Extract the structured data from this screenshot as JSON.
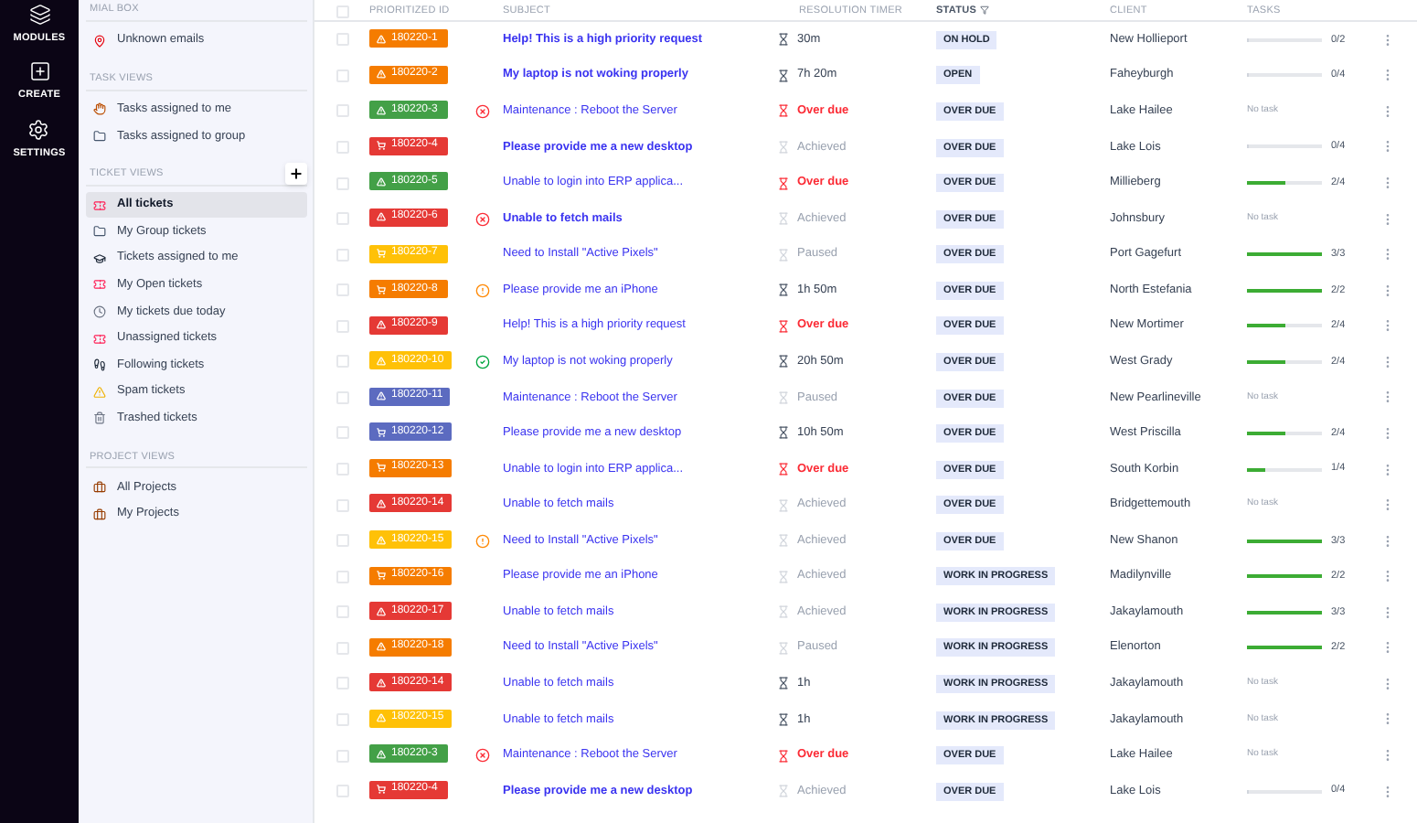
{
  "rail": [
    {
      "kind": "modules",
      "label": "MODULES"
    },
    {
      "kind": "create",
      "label": "CREATE"
    },
    {
      "kind": "settings",
      "label": "SETTINGS"
    }
  ],
  "sidebar": {
    "sections": [
      {
        "title": "MIAL BOX",
        "items": [
          {
            "label": "Unknown emails",
            "kind": "pin",
            "selected": false
          }
        ]
      },
      {
        "title": "TASK VIEWS",
        "items": [
          {
            "label": "Tasks assigned to me",
            "kind": "hand",
            "selected": false
          },
          {
            "label": "Tasks assigned to group",
            "kind": "folder",
            "selected": false
          }
        ]
      },
      {
        "title": "TICKET VIEWS",
        "add": true,
        "items": [
          {
            "label": "All tickets",
            "kind": "ticket",
            "selected": true
          },
          {
            "label": "My Group tickets",
            "kind": "folder",
            "selected": false
          },
          {
            "label": "Tickets assigned to me",
            "kind": "hat",
            "selected": false
          },
          {
            "label": "My Open tickets",
            "kind": "ticket",
            "selected": false
          },
          {
            "label": "My tickets due today",
            "kind": "clock",
            "selected": false
          },
          {
            "label": "Unassigned tickets",
            "kind": "ticket",
            "selected": false
          },
          {
            "label": "Following tickets",
            "kind": "steps",
            "selected": false
          },
          {
            "label": "Spam tickets",
            "kind": "alert",
            "selected": false
          },
          {
            "label": "Trashed tickets",
            "kind": "trash",
            "selected": false
          }
        ]
      },
      {
        "title": "PROJECT VIEWS",
        "items": [
          {
            "label": "All Projects",
            "kind": "case",
            "selected": false
          },
          {
            "label": "My Projects",
            "kind": "case",
            "selected": false
          }
        ]
      }
    ]
  },
  "table": {
    "select_all": {
      "checked": false
    },
    "columns": [
      "PRIORITIZED ID",
      "SUBJECT",
      "RESOLUTION TIMER",
      "STATUS",
      "CLIENT",
      "TASKS"
    ],
    "rows": [
      {
        "checked": false,
        "id": "180220-1",
        "color": "#f57c00",
        "icon": {
          "kind": "warning"
        },
        "subject": "Help! This is a high priority request",
        "unread": true,
        "timer": {
          "kind": "running",
          "text": "30m"
        },
        "status": "ON HOLD",
        "client": "New Hollieport",
        "tasks": {
          "kind": "progress",
          "level": 0,
          "text": "0/2"
        }
      },
      {
        "checked": false,
        "id": "180220-2",
        "color": "#f57c00",
        "icon": {
          "kind": "warning"
        },
        "subject": "My laptop is not woking properly",
        "unread": true,
        "timer": {
          "kind": "running",
          "text": "7h 20m"
        },
        "status": "OPEN",
        "client": "Faheyburgh",
        "tasks": {
          "kind": "progress",
          "level": 0,
          "text": "0/4"
        }
      },
      {
        "checked": false,
        "id": "180220-3",
        "color": "#43a047",
        "icon": {
          "kind": "warning"
        },
        "flag": {
          "kind": "error"
        },
        "subject": "Maintenance : Reboot the Server",
        "unread": false,
        "timer": {
          "kind": "overdue",
          "text": "Over due"
        },
        "status": "OVER DUE",
        "client": "Lake Hailee",
        "tasks": {
          "kind": "none",
          "text": "No task"
        }
      },
      {
        "checked": false,
        "id": "180220-4",
        "color": "#e53935",
        "icon": {
          "kind": "cart"
        },
        "subject": "Please provide me a new desktop",
        "unread": true,
        "timer": {
          "kind": "stopped",
          "text": "Achieved"
        },
        "status": "OVER DUE",
        "client": "Lake Lois",
        "tasks": {
          "kind": "progress",
          "level": 0,
          "text": "0/4"
        }
      },
      {
        "checked": false,
        "id": "180220-5",
        "color": "#43a047",
        "icon": {
          "kind": "warning"
        },
        "subject": "Unable to login into ERP applica...",
        "unread": false,
        "timer": {
          "kind": "overdue",
          "text": "Over due"
        },
        "status": "OVER DUE",
        "client": "Millieberg",
        "tasks": {
          "kind": "progress",
          "level": 0.5,
          "text": "2/4"
        }
      },
      {
        "checked": false,
        "id": "180220-6",
        "color": "#e53935",
        "icon": {
          "kind": "warning"
        },
        "flag": {
          "kind": "error"
        },
        "subject": "Unable to fetch mails",
        "unread": true,
        "timer": {
          "kind": "stopped",
          "text": "Achieved"
        },
        "status": "OVER DUE",
        "client": "Johnsbury",
        "tasks": {
          "kind": "none",
          "text": "No task"
        }
      },
      {
        "checked": false,
        "id": "180220-7",
        "color": "#ffc107",
        "icon": {
          "kind": "cart"
        },
        "subject": "Need to Install \"Active Pixels\"",
        "unread": false,
        "timer": {
          "kind": "stopped",
          "text": "Paused"
        },
        "status": "OVER DUE",
        "client": "Port Gagefurt",
        "tasks": {
          "kind": "progress",
          "level": 1,
          "text": "3/3"
        }
      },
      {
        "checked": false,
        "id": "180220-8",
        "color": "#f57c00",
        "icon": {
          "kind": "cart"
        },
        "flag": {
          "kind": "warning"
        },
        "subject": "Please provide me an iPhone",
        "unread": false,
        "timer": {
          "kind": "running",
          "text": "1h 50m"
        },
        "status": "OVER DUE",
        "client": "North Estefania",
        "tasks": {
          "kind": "progress",
          "level": 1,
          "text": "2/2"
        }
      },
      {
        "checked": false,
        "id": "180220-9",
        "color": "#e53935",
        "icon": {
          "kind": "warning"
        },
        "subject": "Help! This is a high priority request",
        "unread": false,
        "timer": {
          "kind": "overdue",
          "text": "Over due"
        },
        "status": "OVER DUE",
        "client": "New Mortimer",
        "tasks": {
          "kind": "progress",
          "level": 0.5,
          "text": "2/4"
        }
      },
      {
        "checked": false,
        "id": "180220-10",
        "color": "#ffc107",
        "icon": {
          "kind": "warning"
        },
        "flag": {
          "kind": "ok"
        },
        "subject": "My laptop is not woking properly",
        "unread": false,
        "timer": {
          "kind": "running",
          "text": "20h 50m"
        },
        "status": "OVER DUE",
        "client": "West Grady",
        "tasks": {
          "kind": "progress",
          "level": 0.5,
          "text": "2/4"
        }
      },
      {
        "checked": false,
        "id": "180220-11",
        "color": "#5c6bc0",
        "icon": {
          "kind": "warning"
        },
        "subject": "Maintenance : Reboot the Server",
        "unread": false,
        "timer": {
          "kind": "stopped",
          "text": "Paused"
        },
        "status": "OVER DUE",
        "client": "New Pearlineville",
        "tasks": {
          "kind": "none",
          "text": "No task"
        }
      },
      {
        "checked": false,
        "id": "180220-12",
        "color": "#5c6bc0",
        "icon": {
          "kind": "cart"
        },
        "subject": "Please provide me a new desktop",
        "unread": false,
        "timer": {
          "kind": "running",
          "text": "10h 50m"
        },
        "status": "OVER DUE",
        "client": "West Priscilla",
        "tasks": {
          "kind": "progress",
          "level": 0.5,
          "text": "2/4"
        }
      },
      {
        "checked": false,
        "id": "180220-13",
        "color": "#f57c00",
        "icon": {
          "kind": "cart"
        },
        "subject": "Unable to login into ERP applica...",
        "unread": false,
        "timer": {
          "kind": "overdue",
          "text": "Over due"
        },
        "status": "OVER DUE",
        "client": "South Korbin",
        "tasks": {
          "kind": "progress",
          "level": 0.25,
          "text": "1/4"
        }
      },
      {
        "checked": false,
        "id": "180220-14",
        "color": "#e53935",
        "icon": {
          "kind": "warning"
        },
        "subject": "Unable to fetch mails",
        "unread": false,
        "timer": {
          "kind": "stopped",
          "text": "Achieved"
        },
        "status": "OVER DUE",
        "client": "Bridgettemouth",
        "tasks": {
          "kind": "none",
          "text": "No task"
        }
      },
      {
        "checked": false,
        "id": "180220-15",
        "color": "#ffc107",
        "icon": {
          "kind": "warning"
        },
        "flag": {
          "kind": "warning"
        },
        "subject": "Need to Install \"Active Pixels\"",
        "unread": false,
        "timer": {
          "kind": "stopped",
          "text": "Achieved"
        },
        "status": "OVER DUE",
        "client": "New Shanon",
        "tasks": {
          "kind": "progress",
          "level": 1,
          "text": "3/3"
        }
      },
      {
        "checked": false,
        "id": "180220-16",
        "color": "#f57c00",
        "icon": {
          "kind": "cart"
        },
        "subject": "Please provide me an iPhone",
        "unread": false,
        "timer": {
          "kind": "stopped",
          "text": "Achieved"
        },
        "status": "WORK IN PROGRESS",
        "client": "Madilynville",
        "tasks": {
          "kind": "progress",
          "level": 1,
          "text": "2/2"
        }
      },
      {
        "checked": false,
        "id": "180220-17",
        "color": "#e53935",
        "icon": {
          "kind": "warning"
        },
        "subject": "Unable to fetch mails",
        "unread": false,
        "timer": {
          "kind": "stopped",
          "text": "Achieved"
        },
        "status": "WORK IN PROGRESS",
        "client": "Jakaylamouth",
        "tasks": {
          "kind": "progress",
          "level": 1,
          "text": "3/3"
        }
      },
      {
        "checked": false,
        "id": "180220-18",
        "color": "#f57c00",
        "icon": {
          "kind": "warning"
        },
        "subject": "Need to Install \"Active Pixels\"",
        "unread": false,
        "timer": {
          "kind": "stopped",
          "text": "Paused"
        },
        "status": "WORK IN PROGRESS",
        "client": "Elenorton",
        "tasks": {
          "kind": "progress",
          "level": 1,
          "text": "2/2"
        }
      },
      {
        "checked": false,
        "id": "180220-14",
        "color": "#e53935",
        "icon": {
          "kind": "warning"
        },
        "subject": "Unable to fetch mails",
        "unread": false,
        "timer": {
          "kind": "running",
          "text": "1h"
        },
        "status": "WORK IN PROGRESS",
        "client": "Jakaylamouth",
        "tasks": {
          "kind": "none",
          "text": "No task"
        }
      },
      {
        "checked": false,
        "id": "180220-15",
        "color": "#ffc107",
        "icon": {
          "kind": "warning"
        },
        "subject": "Unable to fetch mails",
        "unread": false,
        "timer": {
          "kind": "running",
          "text": "1h"
        },
        "status": "WORK IN PROGRESS",
        "client": "Jakaylamouth",
        "tasks": {
          "kind": "none",
          "text": "No task"
        }
      },
      {
        "checked": false,
        "id": "180220-3",
        "color": "#43a047",
        "icon": {
          "kind": "warning"
        },
        "flag": {
          "kind": "error"
        },
        "subject": "Maintenance : Reboot the Server",
        "unread": false,
        "timer": {
          "kind": "overdue",
          "text": "Over due"
        },
        "status": "OVER DUE",
        "client": "Lake Hailee",
        "tasks": {
          "kind": "none",
          "text": "No task"
        }
      },
      {
        "checked": false,
        "id": "180220-4",
        "color": "#e53935",
        "icon": {
          "kind": "cart"
        },
        "subject": "Please provide me a new desktop",
        "unread": true,
        "timer": {
          "kind": "stopped",
          "text": "Achieved"
        },
        "status": "OVER DUE",
        "client": "Lake Lois",
        "tasks": {
          "kind": "progress",
          "level": 0,
          "text": "0/4"
        }
      }
    ]
  }
}
